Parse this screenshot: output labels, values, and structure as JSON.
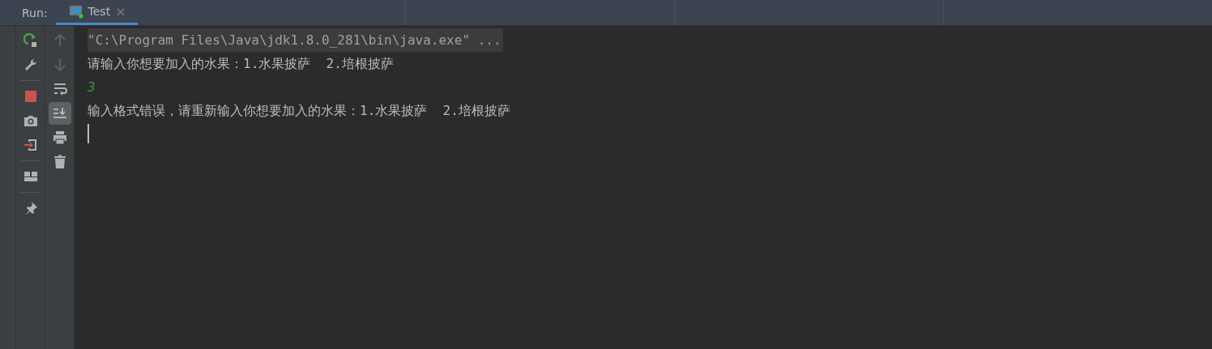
{
  "run_panel": {
    "label": "Run:",
    "tabs": [
      {
        "label": "Test",
        "selected": true,
        "close": "×"
      }
    ]
  },
  "left_toolbar": [
    {
      "kind": "rerun"
    },
    {
      "kind": "wrench"
    },
    {
      "kind": "separator"
    },
    {
      "kind": "stop"
    },
    {
      "kind": "camera"
    },
    {
      "kind": "exit"
    },
    {
      "kind": "separator"
    },
    {
      "kind": "layout"
    },
    {
      "kind": "separator"
    },
    {
      "kind": "pin"
    }
  ],
  "right_toolbar": [
    {
      "kind": "up",
      "disabled": true,
      "selected": false
    },
    {
      "kind": "down",
      "disabled": true,
      "selected": false
    },
    {
      "kind": "wrap",
      "disabled": false,
      "selected": false
    },
    {
      "kind": "scroll-end",
      "disabled": false,
      "selected": true
    },
    {
      "kind": "print",
      "disabled": false,
      "selected": false
    },
    {
      "kind": "trash",
      "disabled": false,
      "selected": false
    }
  ],
  "console": {
    "lines": [
      {
        "kind": "command",
        "text": "\"C:\\Program Files\\Java\\jdk1.8.0_281\\bin\\java.exe\" ..."
      },
      {
        "kind": "output",
        "text": "请输入你想要加入的水果：1.水果披萨  2.培根披萨"
      },
      {
        "kind": "input",
        "text": "3"
      },
      {
        "kind": "output",
        "text": "输入格式错误，请重新输入你想要加入的水果：1.水果披萨  2.培根披萨"
      }
    ],
    "cursor": true
  }
}
